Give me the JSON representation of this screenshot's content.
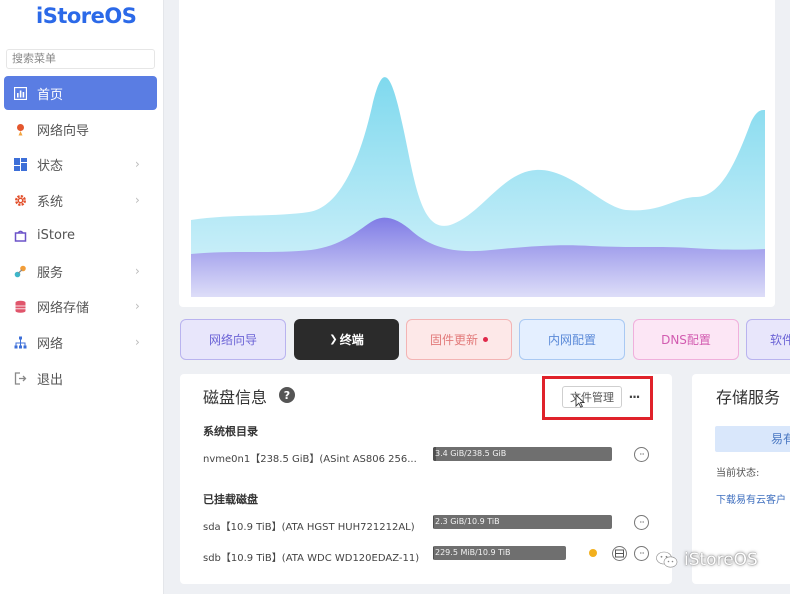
{
  "app": {
    "logo": "iStoreOS"
  },
  "sidebar": {
    "search_placeholder": "搜索菜单",
    "items": [
      {
        "label": "首页",
        "icon": "dashboard-icon",
        "active": true,
        "has_children": false
      },
      {
        "label": "网络向导",
        "icon": "wizard-icon",
        "active": false,
        "has_children": false
      },
      {
        "label": "状态",
        "icon": "status-grid-icon",
        "active": false,
        "has_children": true
      },
      {
        "label": "系统",
        "icon": "gear-icon",
        "active": false,
        "has_children": true
      },
      {
        "label": "iStore",
        "icon": "store-icon",
        "active": false,
        "has_children": false
      },
      {
        "label": "服务",
        "icon": "services-icon",
        "active": false,
        "has_children": true
      },
      {
        "label": "网络存储",
        "icon": "storage-icon",
        "active": false,
        "has_children": true
      },
      {
        "label": "网络",
        "icon": "network-icon",
        "active": false,
        "has_children": true
      },
      {
        "label": "退出",
        "icon": "logout-icon",
        "active": false,
        "has_children": false
      }
    ],
    "chevron": "›"
  },
  "quick_buttons": {
    "network_wizard": "网络向导",
    "terminal": "终端",
    "terminal_prefix": "❯",
    "firmware_update": "固件更新",
    "lan_config": "内网配置",
    "dns_config": "DNS配置",
    "software": "软件"
  },
  "disk_info": {
    "title": "磁盘信息",
    "help": "?",
    "file_manager_label": "文件管理",
    "more_label": "···",
    "system_root_title": "系统根目录",
    "mounted_title": "已挂载磁盘",
    "system_disks": [
      {
        "label": "nvme0n1【238.5 GiB】(ASint AS806 256...",
        "usage": "3.4 GiB/238.5 GiB",
        "used_fraction": 0.014
      }
    ],
    "mounted_disks": [
      {
        "label": "sda【10.9 TiB】(ATA HGST HUH721212AL)",
        "usage": "2.3 GiB/10.9 TiB",
        "used_fraction": 0.002
      },
      {
        "label": "sdb【10.9 TiB】(ATA WDC WD120EDAZ-11)",
        "usage": "229.5 MiB/10.9 TiB",
        "used_fraction": 0.001
      }
    ]
  },
  "storage_service": {
    "title": "存储服务",
    "button": "易有",
    "status_label": "当前状态:",
    "link": "下载易有云客户"
  },
  "watermark": {
    "text": "iStoreOS"
  },
  "colors": {
    "accent": "#5a7de3",
    "logo": "#2b69e8",
    "highlight_box": "#e0222a",
    "chart_back": "#7fd9ee",
    "chart_front": "#7b73e4"
  }
}
